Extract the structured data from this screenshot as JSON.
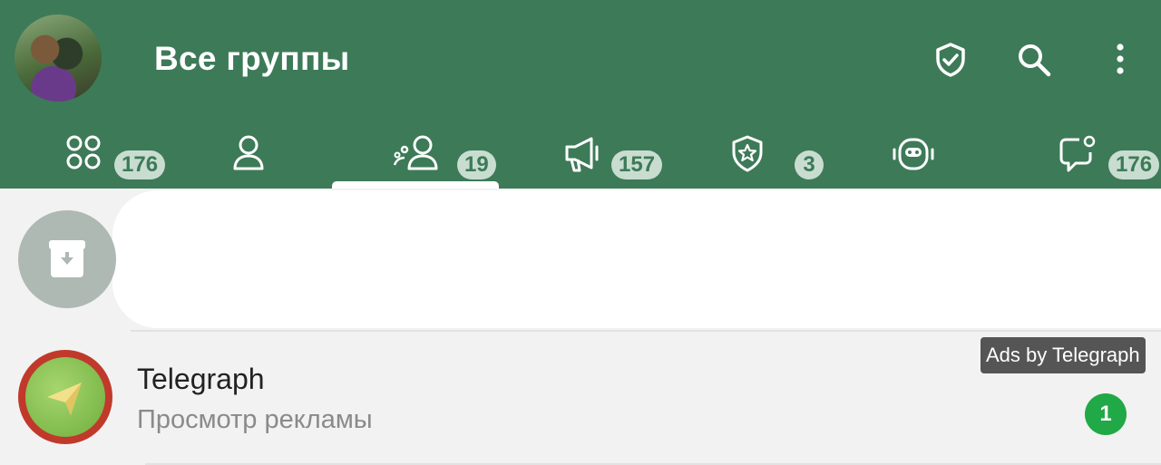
{
  "header": {
    "title": "Все группы",
    "icons": [
      "shield-check-icon",
      "search-icon",
      "more-vertical-icon"
    ]
  },
  "tabs": [
    {
      "icon": "all-chats-icon",
      "badge": "176"
    },
    {
      "icon": "user-icon",
      "badge": ""
    },
    {
      "icon": "groups-icon",
      "badge": "19",
      "selected": true
    },
    {
      "icon": "megaphone-icon",
      "badge": "157"
    },
    {
      "icon": "shield-star-icon",
      "badge": "3"
    },
    {
      "icon": "bot-icon",
      "badge": ""
    },
    {
      "icon": "chat-bubble-icon",
      "badge": "176"
    }
  ],
  "archive": {
    "icon": "archive-icon"
  },
  "ad_chat": {
    "name": "Telegraph",
    "subtitle": "Просмотр рекламы",
    "ads_label": "Ads by Telegraph",
    "unread": "1"
  },
  "colors": {
    "header_bg": "#3d7a58",
    "badge_bg": "#c8ddd0",
    "unread_badge": "#21a847"
  }
}
